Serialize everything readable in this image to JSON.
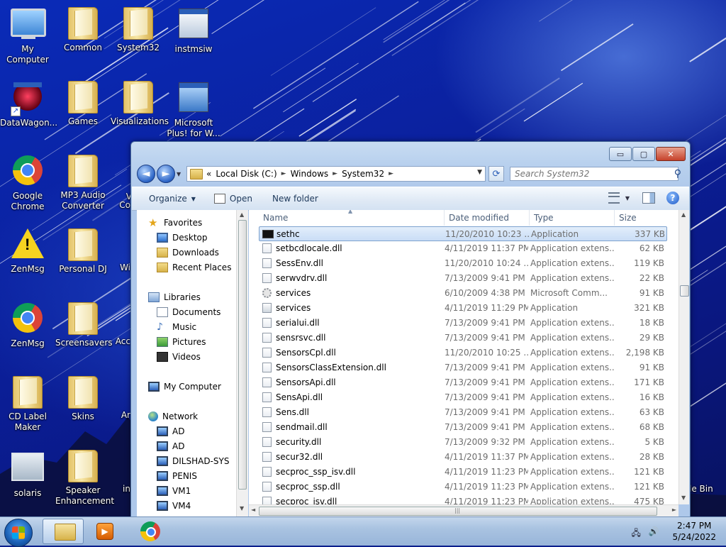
{
  "desktop": {
    "icons": [
      {
        "label": "My Computer",
        "kind": "pc"
      },
      {
        "label": "Common",
        "kind": "folder"
      },
      {
        "label": "System32",
        "kind": "folder"
      },
      {
        "label": "instmsiw",
        "kind": "app"
      },
      {
        "label": "DataWagon...",
        "kind": "app"
      },
      {
        "label": "Games",
        "kind": "folder"
      },
      {
        "label": "Visualizations",
        "kind": "folder"
      },
      {
        "label": "Microsoft Plus! for W...",
        "kind": "app"
      },
      {
        "label": "Google Chrome",
        "kind": "chrome"
      },
      {
        "label": "MP3 Audio Converter",
        "kind": "folder"
      },
      {
        "label": "ZenMsg",
        "kind": "warning"
      },
      {
        "label": "Personal DJ",
        "kind": "folder"
      },
      {
        "label": "ZenMsg",
        "kind": "chrome"
      },
      {
        "label": "Screensavers",
        "kind": "folder"
      },
      {
        "label": "CD Label Maker",
        "kind": "folder"
      },
      {
        "label": "Skins",
        "kind": "folder"
      },
      {
        "label": "solaris",
        "kind": "image"
      },
      {
        "label": "Speaker Enhancement",
        "kind": "folder"
      }
    ],
    "partial_labels": {
      "co": "Co",
      "wi": "Wi",
      "acc": "Acc",
      "ar": "Ar",
      "in": "in",
      "le_bin": "le Bin",
      "v": "V"
    }
  },
  "window": {
    "caption_buttons": {
      "minimize": "▭",
      "maximize": "▢",
      "close": "✕"
    },
    "address": {
      "crumb_more": "«",
      "crumbs": [
        "Local Disk (C:)",
        "Windows",
        "System32"
      ]
    },
    "search_placeholder": "Search System32",
    "commands": {
      "organize": "Organize",
      "open": "Open",
      "new_folder": "New folder"
    },
    "nav": {
      "favorites": "Favorites",
      "favorites_items": [
        "Desktop",
        "Downloads",
        "Recent Places"
      ],
      "libraries": "Libraries",
      "libraries_items": [
        "Documents",
        "Music",
        "Pictures",
        "Videos"
      ],
      "computer": "My Computer",
      "network": "Network",
      "network_items": [
        "AD",
        "AD",
        "DILSHAD-SYS",
        "PENIS",
        "VM1",
        "VM4"
      ]
    },
    "columns": {
      "name": "Name",
      "date": "Date modified",
      "type": "Type",
      "size": "Size"
    },
    "files": [
      {
        "name": "sethc",
        "date": "11/20/2010 10:23 ...",
        "type": "Application",
        "size": "337 KB",
        "icon": "cmd",
        "selected": true
      },
      {
        "name": "setbcdlocale.dll",
        "date": "4/11/2019 11:37 PM",
        "type": "Application extens...",
        "size": "62 KB",
        "icon": "dll"
      },
      {
        "name": "SessEnv.dll",
        "date": "11/20/2010 10:24 ...",
        "type": "Application extens...",
        "size": "119 KB",
        "icon": "dll"
      },
      {
        "name": "serwvdrv.dll",
        "date": "7/13/2009 9:41 PM",
        "type": "Application extens...",
        "size": "22 KB",
        "icon": "dll"
      },
      {
        "name": "services",
        "date": "6/10/2009 4:38 PM",
        "type": "Microsoft Comm...",
        "size": "91 KB",
        "icon": "gear"
      },
      {
        "name": "services",
        "date": "4/11/2019 11:29 PM",
        "type": "Application",
        "size": "321 KB",
        "icon": "exe"
      },
      {
        "name": "serialui.dll",
        "date": "7/13/2009 9:41 PM",
        "type": "Application extens...",
        "size": "18 KB",
        "icon": "dll"
      },
      {
        "name": "sensrsvc.dll",
        "date": "7/13/2009 9:41 PM",
        "type": "Application extens...",
        "size": "29 KB",
        "icon": "dll"
      },
      {
        "name": "SensorsCpl.dll",
        "date": "11/20/2010 10:25 ...",
        "type": "Application extens...",
        "size": "2,198 KB",
        "icon": "dll"
      },
      {
        "name": "SensorsClassExtension.dll",
        "date": "7/13/2009 9:41 PM",
        "type": "Application extens...",
        "size": "91 KB",
        "icon": "dll"
      },
      {
        "name": "SensorsApi.dll",
        "date": "7/13/2009 9:41 PM",
        "type": "Application extens...",
        "size": "171 KB",
        "icon": "dll"
      },
      {
        "name": "SensApi.dll",
        "date": "7/13/2009 9:41 PM",
        "type": "Application extens...",
        "size": "16 KB",
        "icon": "dll"
      },
      {
        "name": "Sens.dll",
        "date": "7/13/2009 9:41 PM",
        "type": "Application extens...",
        "size": "63 KB",
        "icon": "dll"
      },
      {
        "name": "sendmail.dll",
        "date": "7/13/2009 9:41 PM",
        "type": "Application extens...",
        "size": "68 KB",
        "icon": "dll"
      },
      {
        "name": "security.dll",
        "date": "7/13/2009 9:32 PM",
        "type": "Application extens...",
        "size": "5 KB",
        "icon": "dll"
      },
      {
        "name": "secur32.dll",
        "date": "4/11/2019 11:37 PM",
        "type": "Application extens...",
        "size": "28 KB",
        "icon": "dll"
      },
      {
        "name": "secproc_ssp_isv.dll",
        "date": "4/11/2019 11:23 PM",
        "type": "Application extens...",
        "size": "121 KB",
        "icon": "dll"
      },
      {
        "name": "secproc_ssp.dll",
        "date": "4/11/2019 11:23 PM",
        "type": "Application extens...",
        "size": "121 KB",
        "icon": "dll"
      },
      {
        "name": "secproc_isv.dll",
        "date": "4/11/2019 11:23 PM",
        "type": "Application extens...",
        "size": "475 KB",
        "icon": "dll"
      }
    ]
  },
  "taskbar": {
    "clock_time": "2:47 PM",
    "clock_date": "5/24/2022"
  },
  "colors": {
    "selection": "#c9ddf6",
    "taskbar": "#a9c3e1",
    "desktop": "#0b1f9a"
  }
}
